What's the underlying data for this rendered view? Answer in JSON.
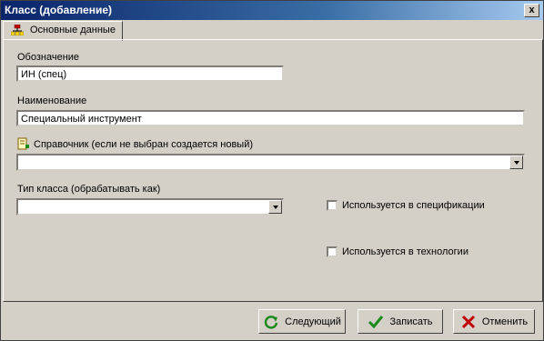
{
  "window": {
    "title": "Класс (добавление)",
    "close_label": "x"
  },
  "tabs": [
    {
      "label": "Основные данные"
    }
  ],
  "form": {
    "designation": {
      "label": "Обозначение",
      "value": "ИН (спец)"
    },
    "name": {
      "label": "Наименование",
      "value": "Специальный инструмент"
    },
    "directory": {
      "label": "Справочник (если не выбран создается новый)",
      "value": ""
    },
    "class_type": {
      "label": "Тип класса (обрабатывать как)",
      "value": ""
    },
    "used_in_spec": {
      "label": "Используется в спецификации",
      "checked": false
    },
    "used_in_tech": {
      "label": "Используется в технологии",
      "checked": false
    }
  },
  "buttons": {
    "next": "Следующий",
    "save": "Записать",
    "cancel": "Отменить"
  },
  "colors": {
    "title_start": "#0a246a",
    "title_end": "#a6caf0",
    "face": "#d4d0c8",
    "save_icon": "#1c8a1c",
    "cancel_icon": "#c00000"
  }
}
